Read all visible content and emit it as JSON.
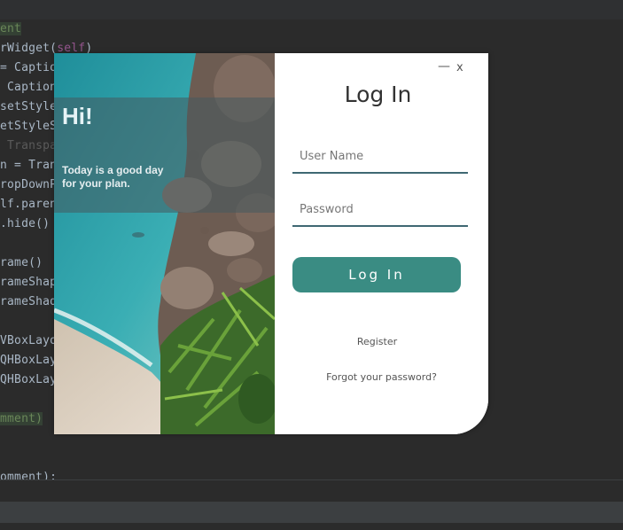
{
  "code_lines": [
    "ent",
    "rWidget(",
    "self",
    ")",
    "= Caption",
    " Caption",
    "setStyle",
    "etStyleS",
    " Transpa",
    "n = Tran",
    "ropDownP",
    "lf.paren",
    ".hide()",
    "rame()",
    "rameShap",
    "rameShad",
    "VBoxLayo",
    "QHBoxLay",
    "QHBoxLay",
    "mment)",
    "omment):"
  ],
  "login": {
    "greeting": "Hi!",
    "tagline_line1": "Today is a good day",
    "tagline_line2": "for your plan.",
    "minimize_label": "—",
    "close_label": "x",
    "title": "Log In",
    "username_placeholder": "User Name",
    "password_placeholder": "Password",
    "login_button": "Log In",
    "register_link": "Register",
    "forgot_link": "Forgot your password?"
  },
  "colors": {
    "accent": "#3a8c83",
    "underline": "#3f6873",
    "editor_bg": "#2b2b2b"
  }
}
